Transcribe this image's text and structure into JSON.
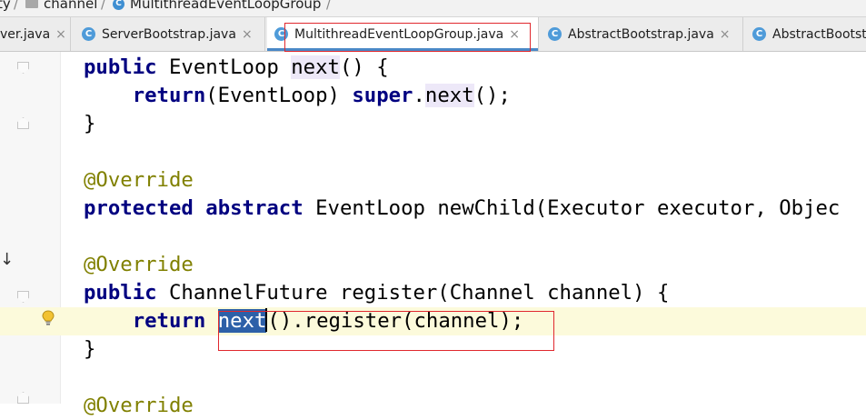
{
  "breadcrumb": {
    "items": [
      {
        "label": "ty",
        "icon": ""
      },
      {
        "label": "channel",
        "icon": "package-icon"
      },
      {
        "label": "MultithreadEventLoopGroup",
        "icon": "class-icon"
      }
    ],
    "separator": "/"
  },
  "tabs": [
    {
      "label": "ver.java",
      "icon": "",
      "active": false
    },
    {
      "label": "ServerBootstrap.java",
      "icon": "class-icon",
      "active": false
    },
    {
      "label": "MultithreadEventLoopGroup.java",
      "icon": "class-icon",
      "active": true
    },
    {
      "label": "AbstractBootstrap.java",
      "icon": "class-icon",
      "active": false
    },
    {
      "label": "AbstractBootst",
      "icon": "class-icon",
      "active": false
    }
  ],
  "close_glyph": "×",
  "class_icon_letter": "C",
  "code": {
    "lines": [
      {
        "tokens": [
          [
            "kw",
            "public"
          ],
          [
            "",
            "EventLoop"
          ],
          [
            "mref",
            "next"
          ],
          [
            "",
            "() {"
          ]
        ]
      },
      {
        "tokens": [
          [
            "",
            "    "
          ],
          [
            "kw",
            "return"
          ],
          [
            "",
            "(EventLoop)"
          ],
          [
            "kw",
            "super"
          ],
          [
            "",
            "."
          ],
          [
            "mref",
            "next"
          ],
          [
            "",
            "();"
          ]
        ]
      },
      {
        "tokens": [
          [
            "",
            "}"
          ]
        ]
      },
      {
        "tokens": []
      },
      {
        "tokens": [
          [
            "ann",
            "@Override"
          ]
        ]
      },
      {
        "tokens": [
          [
            "kw",
            "protected"
          ],
          [
            "kw",
            "abstract"
          ],
          [
            "",
            "EventLoop newChild(Executor executor, Objec"
          ]
        ]
      },
      {
        "tokens": []
      },
      {
        "tokens": [
          [
            "ann",
            "@Override"
          ]
        ]
      },
      {
        "tokens": [
          [
            "kw",
            "public"
          ],
          [
            "",
            "ChannelFuture register(Channel channel) {"
          ]
        ]
      },
      {
        "tokens": [
          [
            "",
            "    "
          ],
          [
            "kw",
            "return"
          ],
          [
            "sel",
            "next"
          ],
          [
            "",
            "().register(channel);"
          ]
        ]
      },
      {
        "tokens": [
          [
            "",
            "}"
          ]
        ]
      },
      {
        "tokens": []
      },
      {
        "tokens": [
          [
            "ann",
            "@Override"
          ]
        ]
      }
    ]
  },
  "colors": {
    "keyword": "#000080",
    "annotation": "#808000",
    "selection": "#2d60a8",
    "current_line": "#fcfadb",
    "highlight_box": "#e0282e",
    "active_tab_underline": "#4a88c7"
  }
}
